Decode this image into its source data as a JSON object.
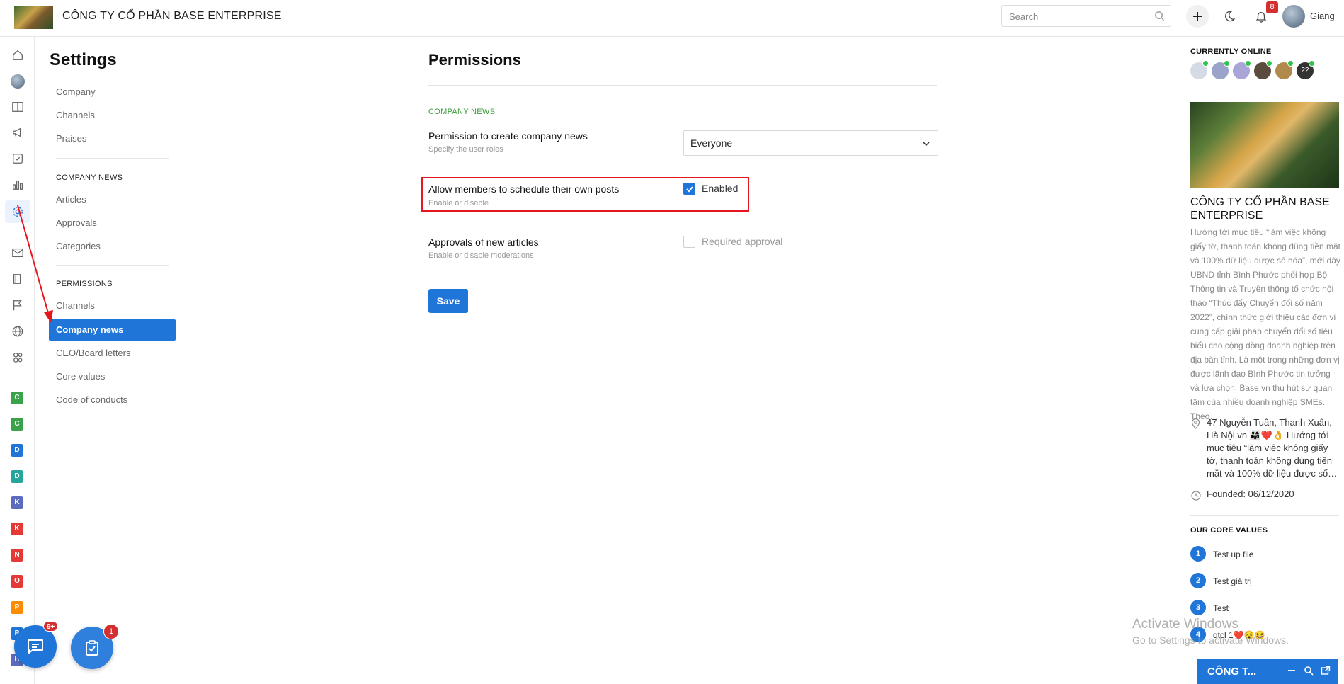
{
  "header": {
    "company_title": "CÔNG TY CỔ PHẦN BASE ENTERPRISE",
    "search_placeholder": "Search",
    "notification_count": "8",
    "user_name": "Giang"
  },
  "rail": {
    "groups": [
      {
        "letter": "C",
        "color": "#3aa34a"
      },
      {
        "letter": "C",
        "color": "#3aa34a"
      },
      {
        "letter": "D",
        "color": "#1f75d8"
      },
      {
        "letter": "D",
        "color": "#26a69a"
      },
      {
        "letter": "K",
        "color": "#5c6bc0"
      },
      {
        "letter": "K",
        "color": "#e53935"
      },
      {
        "letter": "N",
        "color": "#e53935"
      },
      {
        "letter": "O",
        "color": "#e53935"
      },
      {
        "letter": "P",
        "color": "#fb8c00"
      },
      {
        "letter": "P",
        "color": "#1f75d8"
      },
      {
        "letter": "H",
        "color": "#5c6bc0"
      }
    ]
  },
  "settings": {
    "title": "Settings",
    "general": [
      "Company",
      "Channels",
      "Praises"
    ],
    "company_news_heading": "COMPANY NEWS",
    "company_news": [
      "Articles",
      "Approvals",
      "Categories"
    ],
    "permissions_heading": "PERMISSIONS",
    "permissions": [
      "Channels",
      "Company news",
      "CEO/Board letters",
      "Core values",
      "Code of conducts"
    ]
  },
  "main": {
    "title": "Permissions",
    "section_label": "COMPANY NEWS",
    "settings": [
      {
        "title": "Permission to create company news",
        "desc": "Specify the user roles",
        "value": "Everyone"
      },
      {
        "title": "Allow members to schedule their own posts",
        "desc": "Enable or disable",
        "value": "Enabled",
        "checked": true
      },
      {
        "title": "Approvals of new articles",
        "desc": "Enable or disable moderations",
        "value": "Required approval",
        "checked": false
      }
    ],
    "save_label": "Save"
  },
  "right_panel": {
    "online_heading": "CURRENTLY ONLINE",
    "online_more": "22",
    "company_name": "CÔNG TY CỔ PHẦN BASE ENTERPRISE",
    "description": "Hướng tới mục tiêu “làm việc không giấy tờ, thanh toán không dùng tiền mặt và 100% dữ liệu được số hóa”, mới đây UBND tỉnh Bình Phước phối hợp Bộ Thông tin và Truyền thông tổ chức hội thảo “Thúc đẩy Chuyển đổi số năm 2022”, chính thức giới thiệu các đơn vị cung cấp giải pháp chuyển đổi số tiêu biểu cho cộng đồng doanh nghiệp trên địa bàn tỉnh. Là một trong những đơn vị được lãnh đạo Bình Phước tin tưởng và lựa chọn, Base.vn thu hút sự quan tâm của nhiều doanh nghiệp SMEs. Theo…",
    "address": "47 Nguyễn Tuân, Thanh Xuân, Hà Nội vn 👨‍👩‍👧❤️👌 Hướng tới mục tiêu “làm việc không giấy tờ, thanh toán không dùng tiền mặt và 100% dữ liệu được số…",
    "founded": "Founded: 06/12/2020",
    "core_values_heading": "OUR CORE VALUES",
    "core_values": [
      {
        "num": "1",
        "label": "Test up file"
      },
      {
        "num": "2",
        "label": "Test giá trị"
      },
      {
        "num": "3",
        "label": "Test"
      },
      {
        "num": "4",
        "label": "qtcl 1❤️😵😆"
      }
    ]
  },
  "floating": {
    "chat_badge": "9+",
    "task_badge": "1",
    "chat_window_title": "CÔNG T..."
  },
  "watermark": {
    "line1": "Activate Windows",
    "line2": "Go to Settings to activate Windows."
  },
  "colors": {
    "accent": "#1f75d8",
    "highlight_border": "#e5161d",
    "section_green": "#3d9a3d",
    "badge_red": "#d32f2f",
    "online_green": "#2fc34b"
  }
}
